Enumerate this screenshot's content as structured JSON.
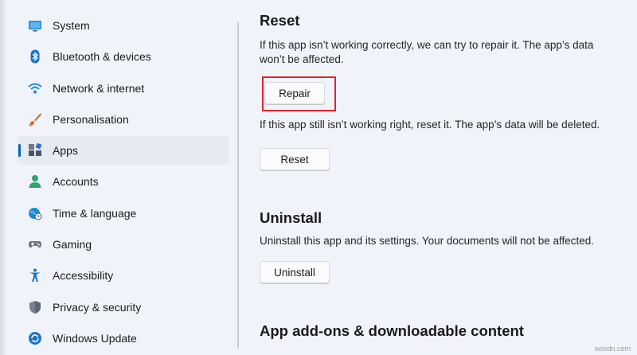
{
  "sidebar": {
    "items": [
      {
        "label": "System",
        "icon": "monitor-icon",
        "active": false
      },
      {
        "label": "Bluetooth & devices",
        "icon": "bluetooth-icon",
        "active": false
      },
      {
        "label": "Network & internet",
        "icon": "wifi-icon",
        "active": false
      },
      {
        "label": "Personalisation",
        "icon": "brush-icon",
        "active": false
      },
      {
        "label": "Apps",
        "icon": "apps-icon",
        "active": true
      },
      {
        "label": "Accounts",
        "icon": "person-icon",
        "active": false
      },
      {
        "label": "Time & language",
        "icon": "globe-clock-icon",
        "active": false
      },
      {
        "label": "Gaming",
        "icon": "gamepad-icon",
        "active": false
      },
      {
        "label": "Accessibility",
        "icon": "accessibility-icon",
        "active": false
      },
      {
        "label": "Privacy & security",
        "icon": "shield-icon",
        "active": false
      },
      {
        "label": "Windows Update",
        "icon": "update-icon",
        "active": false
      }
    ]
  },
  "reset_section": {
    "title": "Reset",
    "repair_description_line1": "If this app isn’t working correctly, we can try to repair it. The app’s data",
    "repair_description_line2": "won’t be affected.",
    "repair_button": "Repair",
    "reset_description": "If this app still isn’t working right, reset it. The app’s data will be deleted.",
    "reset_button": "Reset"
  },
  "uninstall_section": {
    "title": "Uninstall",
    "description": "Uninstall this app and its settings. Your documents will not be affected.",
    "uninstall_button": "Uninstall"
  },
  "addons_section": {
    "title": "App add-ons & downloadable content"
  },
  "watermark": "wsxdn.com",
  "colors": {
    "accent": "#0067c0",
    "highlight": "#e0232c",
    "background": "#f0f3f9"
  }
}
